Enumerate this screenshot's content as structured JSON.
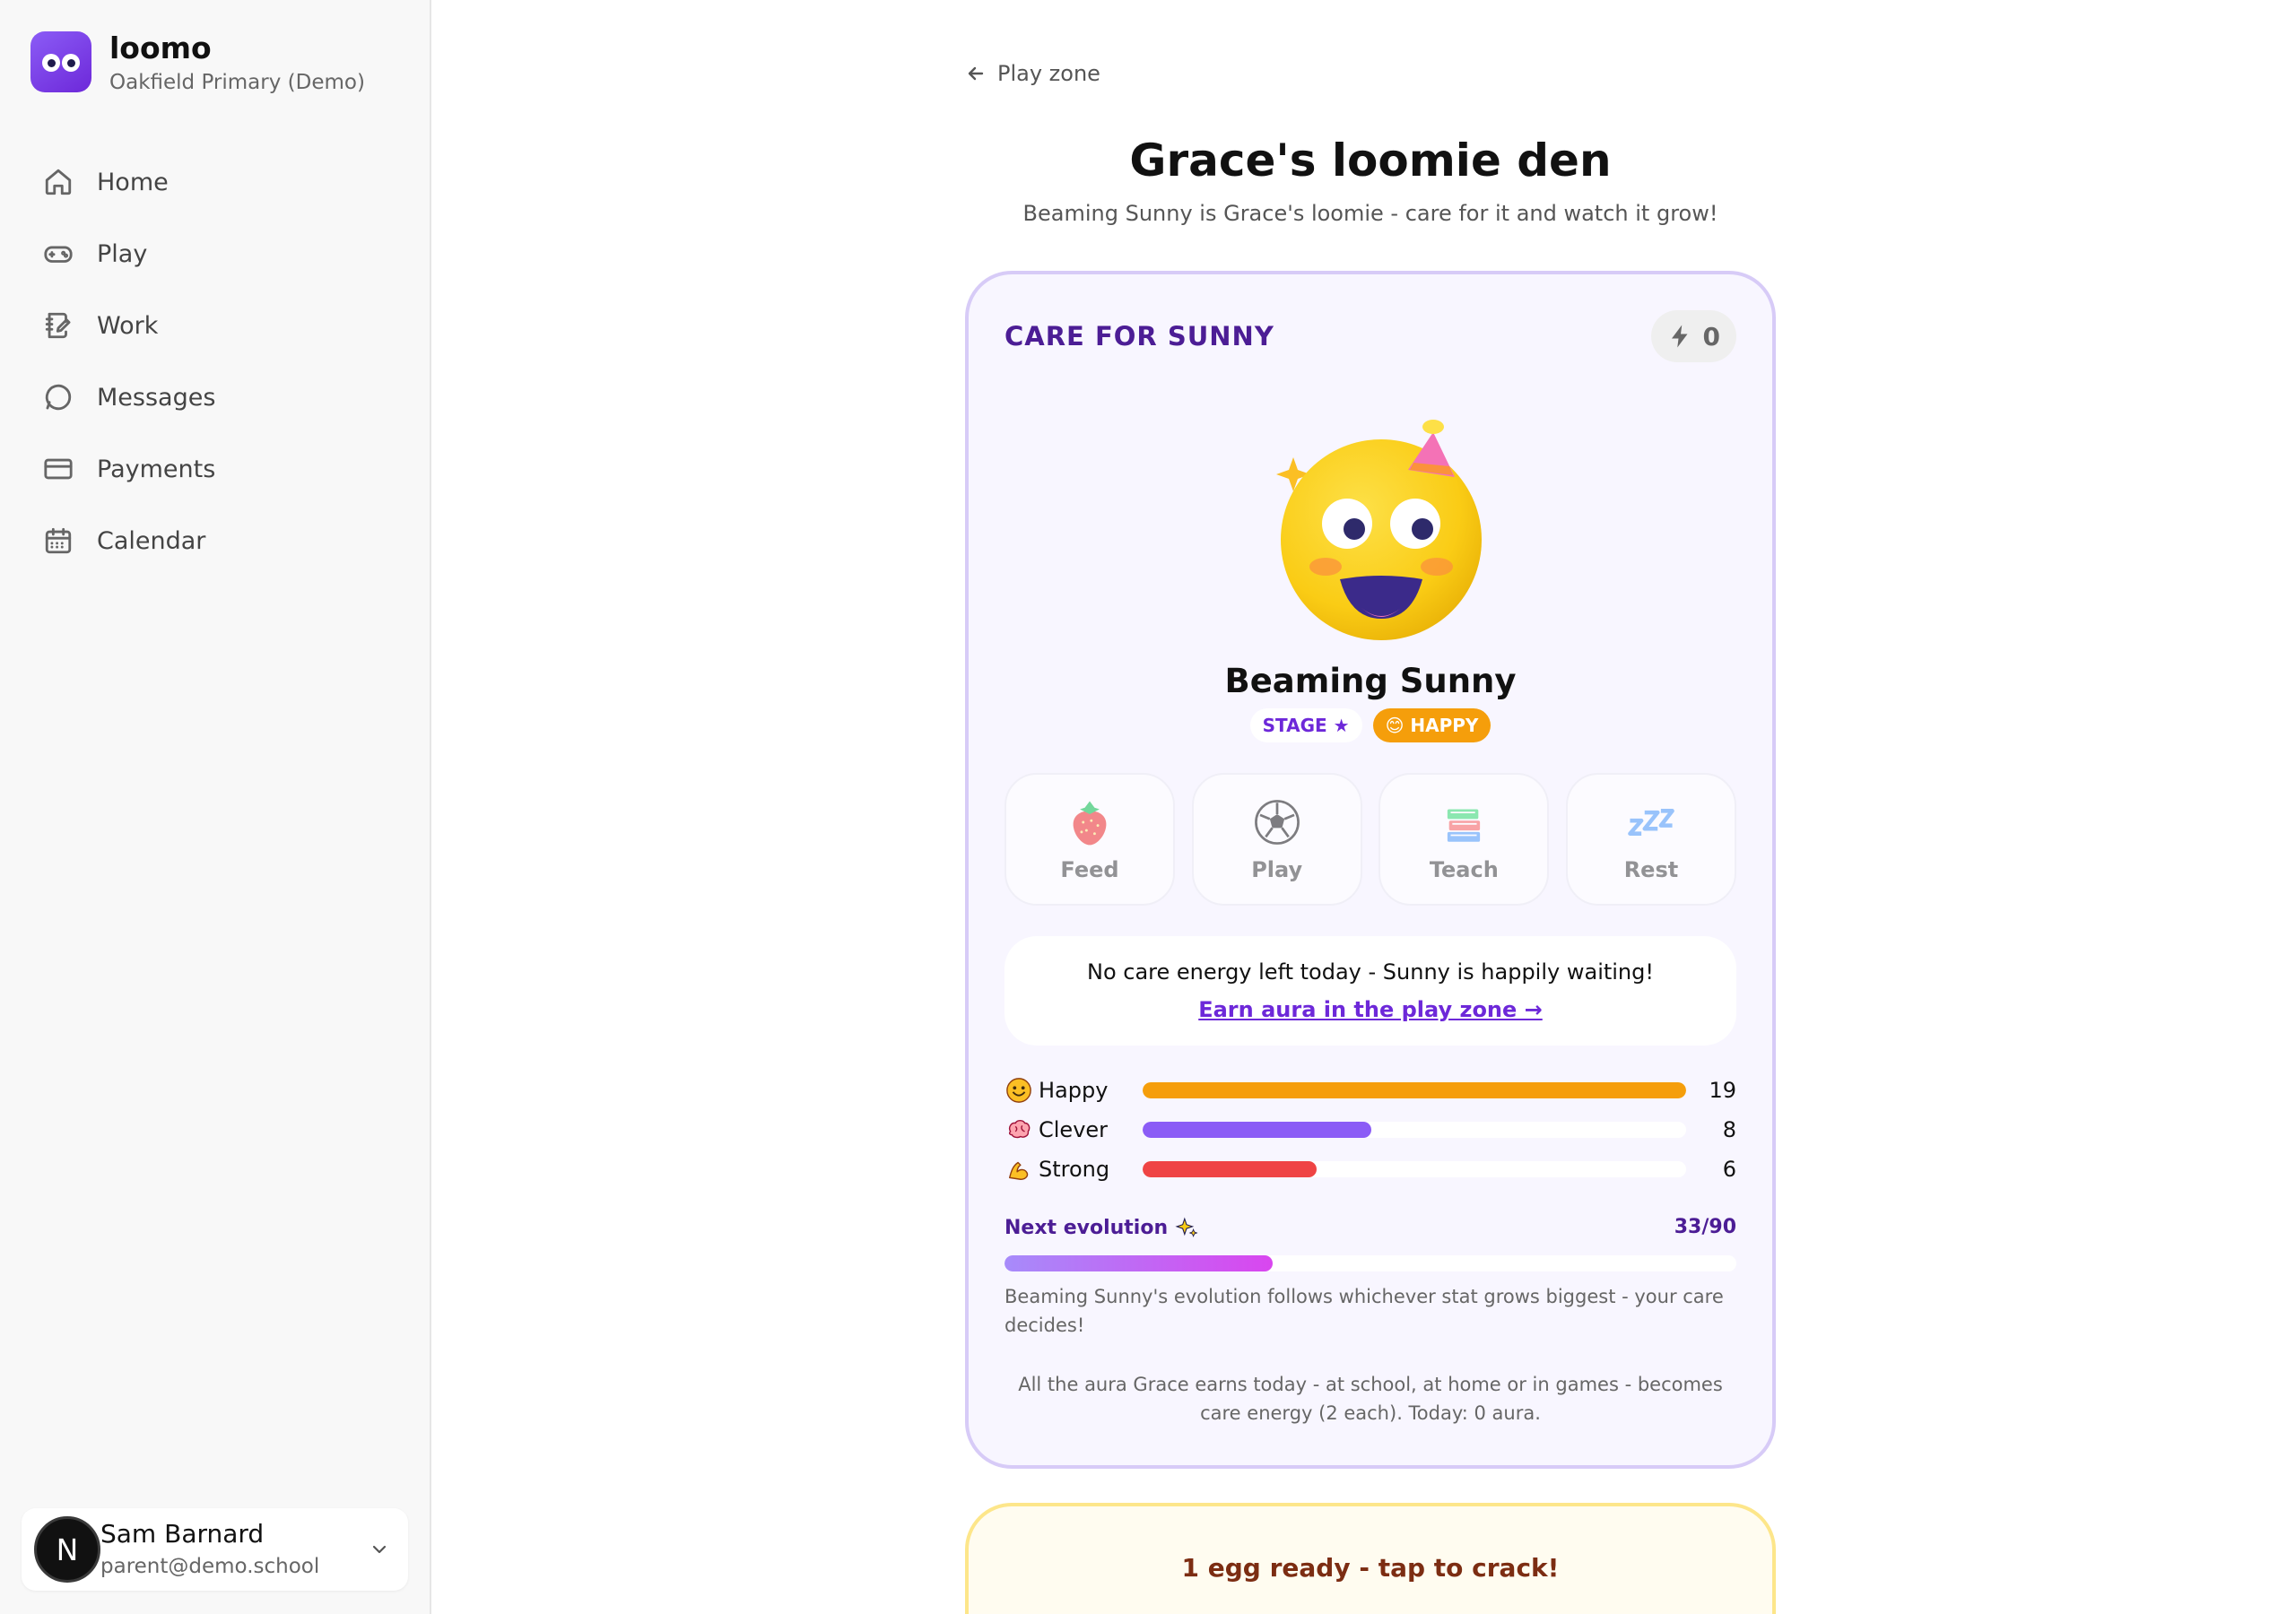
{
  "brand": {
    "name": "loomo",
    "school": "Oakfield Primary (Demo)"
  },
  "nav": [
    {
      "label": "Home",
      "icon": "home-icon"
    },
    {
      "label": "Play",
      "icon": "gamepad-icon"
    },
    {
      "label": "Work",
      "icon": "notebook-icon"
    },
    {
      "label": "Messages",
      "icon": "message-icon"
    },
    {
      "label": "Payments",
      "icon": "credit-card-icon"
    },
    {
      "label": "Calendar",
      "icon": "calendar-icon"
    }
  ],
  "user": {
    "initial": "N",
    "name": "Sam Barnard",
    "email": "parent@demo.school"
  },
  "header": {
    "back_label": "Play zone",
    "title": "Grace's loomie den",
    "subtitle": "Beaming Sunny is Grace's loomie - care for it and watch it grow!"
  },
  "care": {
    "title": "CARE FOR SUNNY",
    "energy": "0",
    "pet_name": "Beaming Sunny",
    "stage_label": "STAGE ★",
    "mood_label": "😊 HAPPY",
    "actions": [
      {
        "label": "Feed",
        "icon": "strawberry-icon"
      },
      {
        "label": "Play",
        "icon": "soccer-ball-icon"
      },
      {
        "label": "Teach",
        "icon": "books-icon"
      },
      {
        "label": "Rest",
        "icon": "zzz-icon"
      }
    ],
    "notice": "No care energy left today - Sunny is happily waiting!",
    "notice_link": "Earn aura in the play zone →",
    "stats": [
      {
        "label": "Happy",
        "value": "19",
        "fraction": 1.0,
        "color": "#f59e0b",
        "icon": "smiley-icon"
      },
      {
        "label": "Clever",
        "value": "8",
        "fraction": 0.42,
        "color": "#8b5cf6",
        "icon": "brain-icon"
      },
      {
        "label": "Strong",
        "value": "6",
        "fraction": 0.32,
        "color": "#ef4444",
        "icon": "flexed-arm-icon"
      }
    ],
    "evolution_label": "Next evolution",
    "evolution_count": "33/90",
    "evolution_fraction": 0.3667,
    "evolution_note": "Beaming Sunny's evolution follows whichever stat grows biggest - your care decides!",
    "aura_note": "All the aura Grace earns today - at school, at home or in games - becomes care energy (2 each). Today: 0 aura."
  },
  "egg": {
    "title": "1 egg ready - tap to crack!"
  },
  "colors": {
    "accent": "#6d28d9",
    "happy": "#f59e0b",
    "card_border": "#d7cbf7",
    "egg_border": "#fde68a"
  }
}
